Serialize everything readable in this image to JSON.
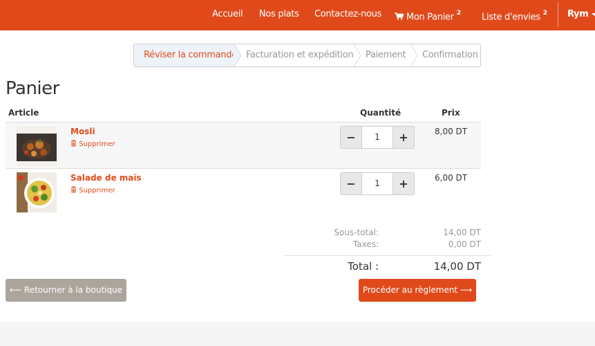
{
  "nav": {
    "items": [
      {
        "label": "Accueil"
      },
      {
        "label": "Nos plats"
      },
      {
        "label": "Contactez-nous"
      },
      {
        "label": "Mon Panier",
        "badge": "2"
      },
      {
        "label": "Liste d'envies",
        "badge": "2"
      }
    ],
    "user": "Rym"
  },
  "steps": [
    "Réviser la commande",
    "Facturation et expédition",
    "Paiement",
    "Confirmation"
  ],
  "page_title": "Panier",
  "table_headers": {
    "article": "Article",
    "quantity": "Quantité",
    "price": "Prix"
  },
  "cart": [
    {
      "name": "Mosli",
      "remove": "Supprimer",
      "quantity": "1",
      "price": "8,00 DT"
    },
    {
      "name": "Salade de maïs",
      "remove": "Supprimer",
      "quantity": "1",
      "price": "6,00 DT"
    }
  ],
  "summary": {
    "subtotal_label": "Sous-total:",
    "subtotal": "14,00 DT",
    "tax_label": "Taxes:",
    "tax": "0,00 DT",
    "total_label": "Total :",
    "total": "14,00 DT"
  },
  "buttons": {
    "back": "Retourner à la boutique",
    "checkout": "Procéder au règlement"
  },
  "colors": {
    "accent": "#e04a1b",
    "back_button": "#aca59c"
  },
  "icons": {
    "cart": "shopping-cart-icon",
    "remove": "trash-icon",
    "back": "arrow-left-icon",
    "checkout": "arrow-right-icon"
  }
}
